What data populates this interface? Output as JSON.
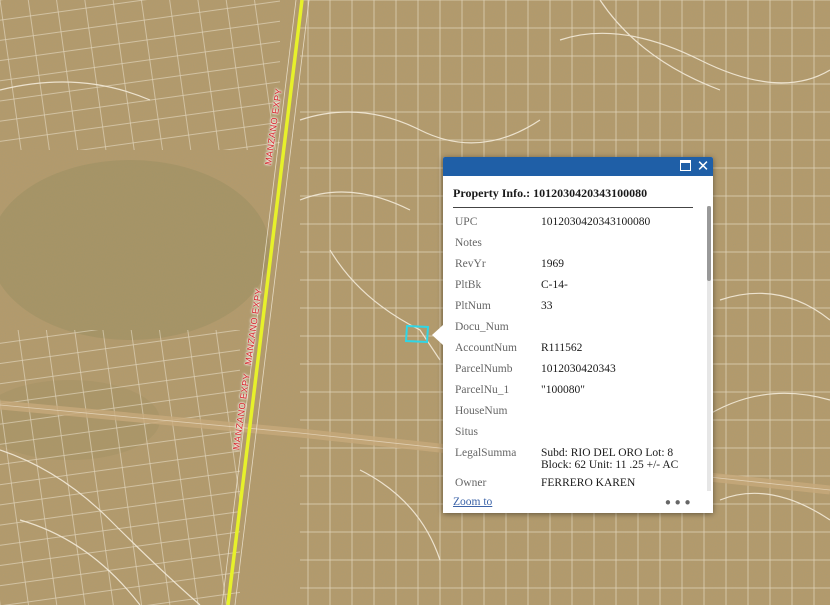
{
  "map": {
    "road_labels": [
      "MANZANO EXPY",
      "MANZANO EXPY",
      "MANZANO EXPY"
    ],
    "colors": {
      "terrain": "#b59b6a",
      "parcel_line": "#f3ead8",
      "highway": "#e7f12a",
      "road": "#c7a97a",
      "selected_parcel": "#2fd6e6"
    }
  },
  "popup": {
    "colors": {
      "titlebar": "#1f5fa7",
      "link": "#3b63a8"
    },
    "icons": {
      "maximize": "maximize-icon",
      "close": "close-icon",
      "more": "more-icon"
    },
    "close_glyph": "✕",
    "title": "Property Info.: 1012030420343100080",
    "fields": [
      {
        "key": "UPC",
        "value": "1012030420343100080"
      },
      {
        "key": "Notes",
        "value": ""
      },
      {
        "key": "RevYr",
        "value": "1969"
      },
      {
        "key": "PltBk",
        "value": "C-14-"
      },
      {
        "key": "PltNum",
        "value": "33"
      },
      {
        "key": "Docu_Num",
        "value": ""
      },
      {
        "key": "AccountNum",
        "value": "R111562"
      },
      {
        "key": "ParcelNumb",
        "value": "1012030420343"
      },
      {
        "key": "ParcelNu_1",
        "value": "\"100080\""
      },
      {
        "key": "HouseNum",
        "value": ""
      },
      {
        "key": "Situs",
        "value": ""
      },
      {
        "key": "LegalSumma",
        "value": "Subd: RIO DEL ORO Lot: 8 Block: 62 Unit: 11 .25 +/- AC"
      },
      {
        "key": "Owner",
        "value": "FERRERO KAREN"
      }
    ],
    "zoom_link": "Zoom to",
    "more_glyph": "•••"
  }
}
